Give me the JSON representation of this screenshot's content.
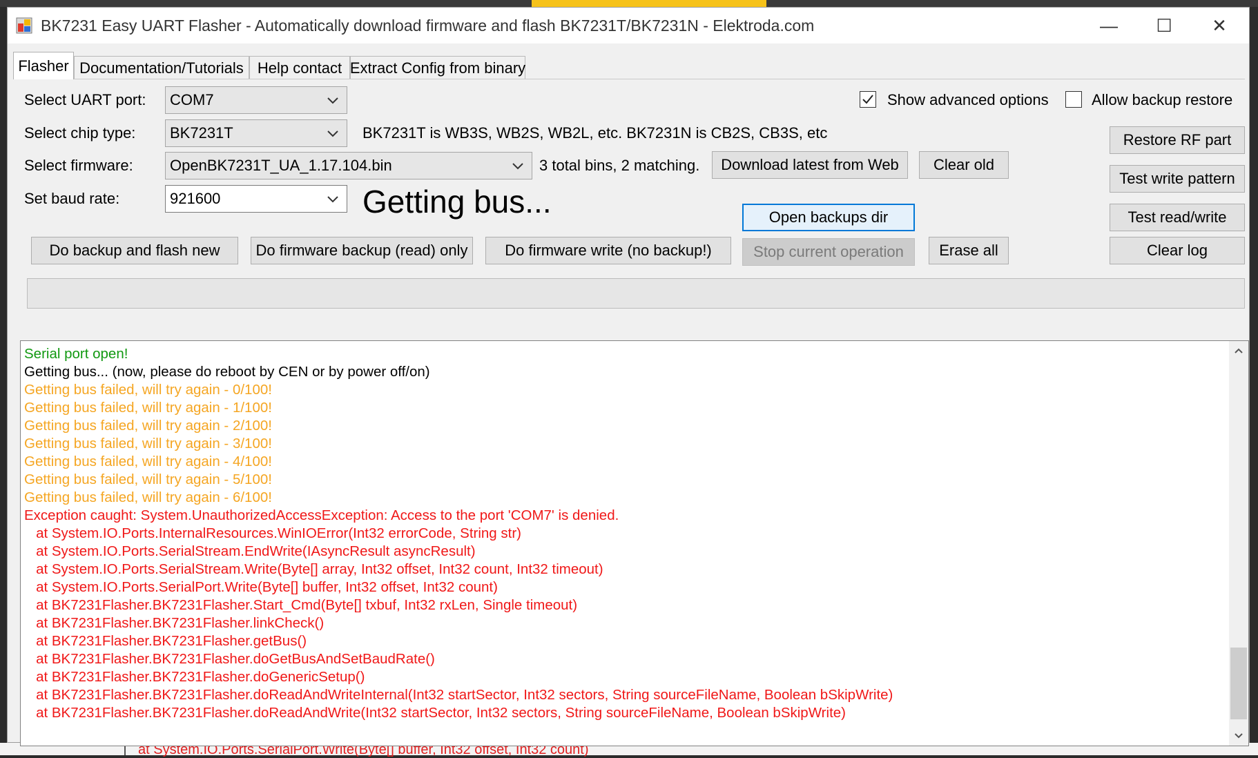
{
  "window": {
    "title": "BK7231 Easy UART Flasher - Automatically download firmware and flash BK7231T/BK7231N  - Elektroda.com",
    "minimize_glyph": "—",
    "maximize_glyph": "☐",
    "close_glyph": "✕"
  },
  "tabs": [
    {
      "label": "Flasher",
      "active": true
    },
    {
      "label": "Documentation/Tutorials",
      "active": false
    },
    {
      "label": "Help contact",
      "active": false
    },
    {
      "label": "Extract Config from binary",
      "active": false
    }
  ],
  "form": {
    "uart_label": "Select UART port:",
    "uart_value": "COM7",
    "chip_label": "Select chip type:",
    "chip_value": "BK7231T",
    "chip_hint": "BK7231T is WB3S, WB2S, WB2L, etc. BK7231N is CB2S, CB3S, etc",
    "firmware_label": "Select firmware:",
    "firmware_value": "OpenBK7231T_UA_1.17.104.bin",
    "bins_info": "3 total bins, 2 matching.",
    "baud_label": "Set baud rate:",
    "baud_value": "921600"
  },
  "status": "Getting bus...",
  "options": {
    "show_advanced_label": "Show advanced options",
    "show_advanced_checked": true,
    "allow_backup_restore_label": "Allow backup restore",
    "allow_backup_restore_checked": false
  },
  "buttons": {
    "download_latest": "Download latest from Web",
    "clear_old": "Clear old",
    "open_backups_dir": "Open backups dir",
    "backup_and_flash": "Do backup and flash new",
    "backup_only": "Do firmware backup (read) only",
    "write_no_backup": "Do firmware write (no backup!)",
    "stop_operation": "Stop current operation",
    "erase_all": "Erase all",
    "restore_rf": "Restore RF part",
    "test_write_pattern": "Test write pattern",
    "test_read_write": "Test read/write",
    "clear_log": "Clear log"
  },
  "progress_percent": 0,
  "colors": {
    "green": "#119911",
    "black": "#000000",
    "orange": "#f5a623",
    "red": "#f01818"
  },
  "log": [
    {
      "text": "Serial port open!",
      "color": "green"
    },
    {
      "text": "Getting bus... (now, please do reboot by CEN or by power off/on)",
      "color": "black"
    },
    {
      "text": "Getting bus failed, will try again - 0/100!",
      "color": "orange"
    },
    {
      "text": "Getting bus failed, will try again - 1/100!",
      "color": "orange"
    },
    {
      "text": "Getting bus failed, will try again - 2/100!",
      "color": "orange"
    },
    {
      "text": "Getting bus failed, will try again - 3/100!",
      "color": "orange"
    },
    {
      "text": "Getting bus failed, will try again - 4/100!",
      "color": "orange"
    },
    {
      "text": "Getting bus failed, will try again - 5/100!",
      "color": "orange"
    },
    {
      "text": "Getting bus failed, will try again - 6/100!",
      "color": "orange"
    },
    {
      "text": "Exception caught: System.UnauthorizedAccessException: Access to the port 'COM7' is denied.",
      "color": "red"
    },
    {
      "text": "   at System.IO.Ports.InternalResources.WinIOError(Int32 errorCode, String str)",
      "color": "red"
    },
    {
      "text": "   at System.IO.Ports.SerialStream.EndWrite(IAsyncResult asyncResult)",
      "color": "red"
    },
    {
      "text": "   at System.IO.Ports.SerialStream.Write(Byte[] array, Int32 offset, Int32 count, Int32 timeout)",
      "color": "red"
    },
    {
      "text": "   at System.IO.Ports.SerialPort.Write(Byte[] buffer, Int32 offset, Int32 count)",
      "color": "red"
    },
    {
      "text": "   at BK7231Flasher.BK7231Flasher.Start_Cmd(Byte[] txbuf, Int32 rxLen, Single timeout)",
      "color": "red"
    },
    {
      "text": "   at BK7231Flasher.BK7231Flasher.linkCheck()",
      "color": "red"
    },
    {
      "text": "   at BK7231Flasher.BK7231Flasher.getBus()",
      "color": "red"
    },
    {
      "text": "   at BK7231Flasher.BK7231Flasher.doGetBusAndSetBaudRate()",
      "color": "red"
    },
    {
      "text": "   at BK7231Flasher.BK7231Flasher.doGenericSetup()",
      "color": "red"
    },
    {
      "text": "   at BK7231Flasher.BK7231Flasher.doReadAndWriteInternal(Int32 startSector, Int32 sectors, String sourceFileName, Boolean bSkipWrite)",
      "color": "red"
    },
    {
      "text": "   at BK7231Flasher.BK7231Flasher.doReadAndWrite(Int32 startSector, Int32 sectors, String sourceFileName, Boolean bSkipWrite)",
      "color": "red"
    }
  ],
  "background": {
    "bottom_text": "at System.IO.Ports.SerialPort.Write(Byte[] buffer, Int32 offset, Int32 count)"
  }
}
